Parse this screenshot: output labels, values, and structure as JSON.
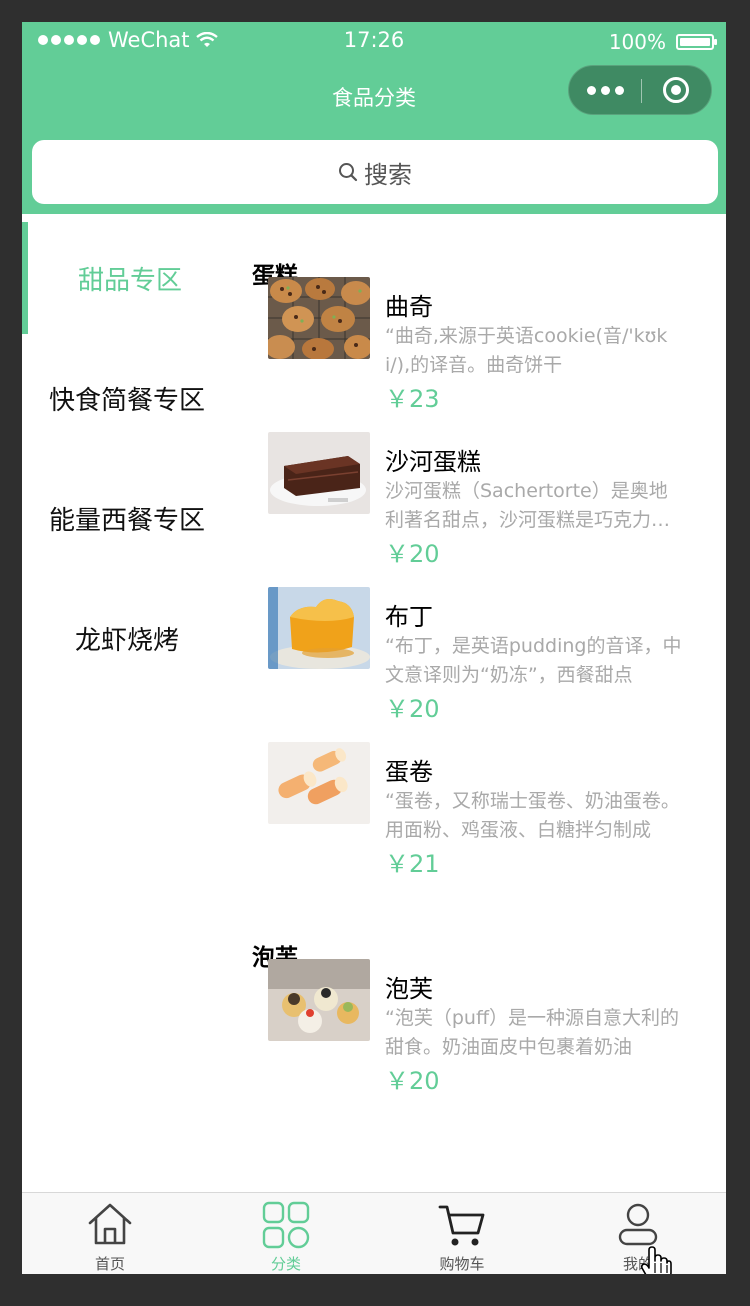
{
  "status_bar": {
    "carrier": "WeChat",
    "time": "17:26",
    "battery": "100%"
  },
  "nav": {
    "title": "食品分类"
  },
  "search": {
    "label": "搜索"
  },
  "categories": [
    {
      "label": "甜品专区",
      "active": true
    },
    {
      "label": "快食简餐专区"
    },
    {
      "label": "能量西餐专区"
    },
    {
      "label": "龙虾烧烤"
    }
  ],
  "sections": [
    {
      "title": "蛋糕",
      "items": [
        {
          "name": "曲奇",
          "desc": "“曲奇,来源于英语cookie(音/'kʊki/),的译音。曲奇饼干",
          "price": "￥23",
          "image": "cookies"
        },
        {
          "name": "沙河蛋糕",
          "desc": "沙河蛋糕（Sachertorte）是奥地利著名甜点，沙河蛋糕是巧克力蛋糕",
          "price": "￥20",
          "image": "chocolate-cake"
        },
        {
          "name": "布丁",
          "desc": "“布丁，是英语pudding的音译，中文意译则为“奶冻”，西餐甜点",
          "price": "￥20",
          "image": "pudding"
        },
        {
          "name": "蛋卷",
          "desc": "“蛋卷，又称瑞士蛋卷、奶油蛋卷。用面粉、鸡蛋液、白糖拌匀制成",
          "price": "￥21",
          "image": "egg-rolls"
        }
      ]
    },
    {
      "title": "泡芙",
      "items": [
        {
          "name": "泡芙",
          "desc": "“泡芙（puff）是一种源自意大利的甜食。奶油面皮中包裹着奶油",
          "price": "￥20",
          "image": "puffs"
        }
      ]
    }
  ],
  "tabbar": [
    {
      "label": "首页",
      "icon": "home-icon"
    },
    {
      "label": "分类",
      "icon": "category-grid-icon",
      "active": true
    },
    {
      "label": "购物车",
      "icon": "cart-icon"
    },
    {
      "label": "我的",
      "icon": "profile-icon"
    }
  ],
  "colors": {
    "accent": "#62cd97",
    "price": "#62cd97",
    "desc": "#a9a9a9"
  }
}
